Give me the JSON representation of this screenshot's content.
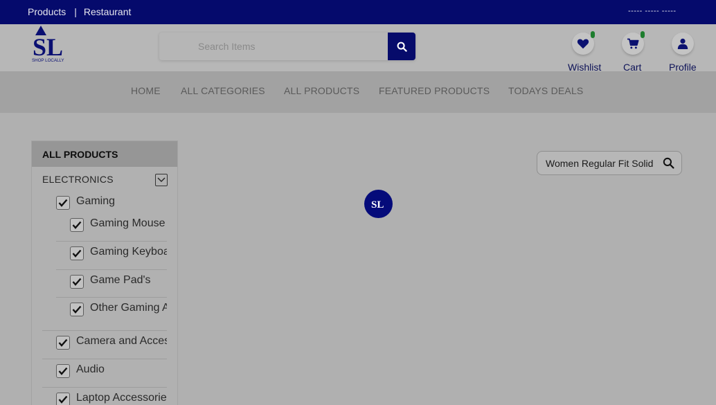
{
  "topbar": {
    "products_link": "Products",
    "separator": "|",
    "restaurant_link": "Restaurant",
    "right_text": "----- ----- -----"
  },
  "header": {
    "logo_text": "SL",
    "logo_caption": "SHOP LOCALLY",
    "search": {
      "placeholder": "Search Items",
      "value": ""
    },
    "icons": [
      {
        "name": "heart-icon",
        "label": "Wishlist"
      },
      {
        "name": "cart-icon",
        "label": "Cart"
      },
      {
        "name": "user-icon",
        "label": "Profile"
      }
    ]
  },
  "nav": {
    "items": [
      "HOME",
      "ALL CATEGORIES",
      "ALL PRODUCTS",
      "FEATURED PRODUCTS",
      "TODAYS DEALS"
    ]
  },
  "sidebar": {
    "title": "ALL PRODUCTS",
    "category": "ELECTRONICS",
    "groups": [
      {
        "label": "Gaming",
        "checked": true
      },
      {
        "label": "Gaming Mouse",
        "checked": true
      },
      {
        "label": "Gaming Keyboard",
        "checked": true
      },
      {
        "label": "Game Pad's",
        "checked": true
      },
      {
        "label": "Other Gaming Accessories",
        "checked": true
      },
      {
        "label": "Camera and Accessories",
        "checked": true
      },
      {
        "label": "Audio",
        "checked": true
      },
      {
        "label": "Laptop Accessories",
        "checked": true
      }
    ]
  },
  "product_search": {
    "value": "Women Regular Fit Solid"
  },
  "loader": {
    "logo_text": "SL"
  },
  "colors": {
    "brand_navy": "#050a6c",
    "badge_green": "#1e7d2e",
    "overlay_gray": "#b0b0b0"
  }
}
